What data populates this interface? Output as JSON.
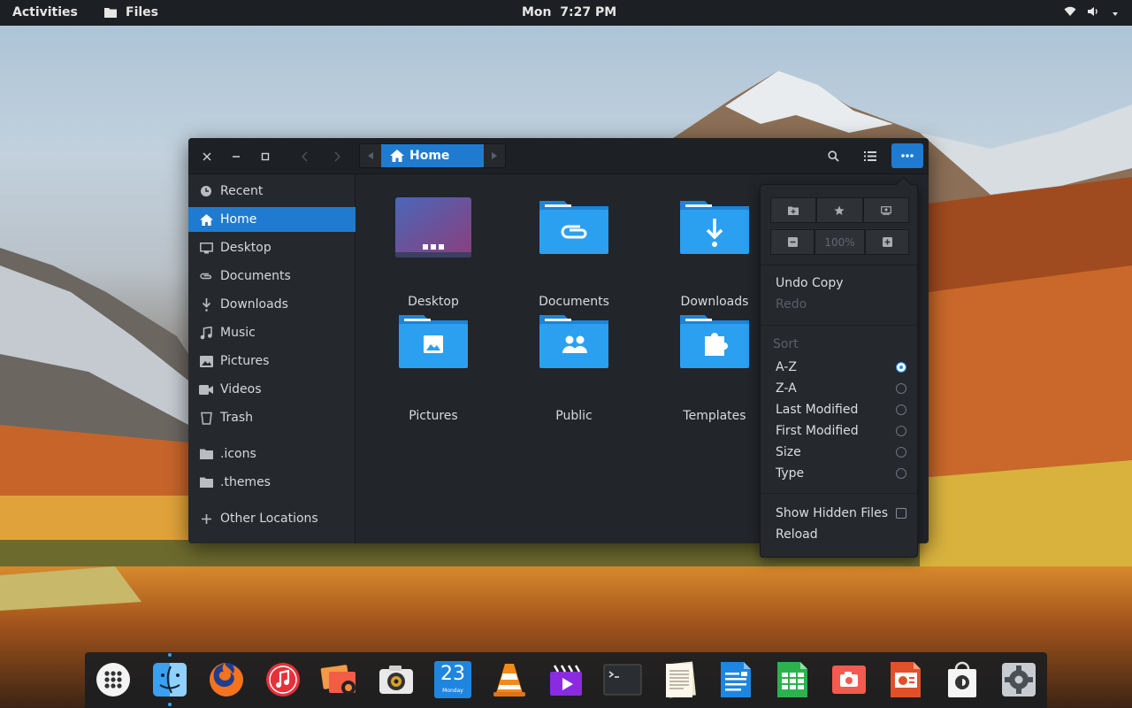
{
  "topbar": {
    "activities": "Activities",
    "app_name": "Files",
    "clock": "Mon  7:27 PM"
  },
  "window": {
    "path": {
      "current": "Home"
    },
    "sidebar": [
      {
        "label": "Recent",
        "icon": "clock-icon"
      },
      {
        "label": "Home",
        "icon": "home-icon",
        "active": true
      },
      {
        "label": "Desktop",
        "icon": "desktop-icon"
      },
      {
        "label": "Documents",
        "icon": "paperclip-icon"
      },
      {
        "label": "Downloads",
        "icon": "download-icon"
      },
      {
        "label": "Music",
        "icon": "music-note-icon"
      },
      {
        "label": "Pictures",
        "icon": "image-icon"
      },
      {
        "label": "Videos",
        "icon": "video-camera-icon"
      },
      {
        "label": "Trash",
        "icon": "trash-icon"
      },
      {
        "label": ".icons",
        "icon": "folder-icon"
      },
      {
        "label": ".themes",
        "icon": "folder-icon"
      },
      {
        "label": "Other Locations",
        "icon": "plus-icon"
      }
    ],
    "files": [
      {
        "label": "Desktop"
      },
      {
        "label": "Documents"
      },
      {
        "label": "Downloads"
      },
      {
        "label": "Pictures"
      },
      {
        "label": "Public"
      },
      {
        "label": "Templates"
      }
    ]
  },
  "menu": {
    "zoom": "100%",
    "undo": "Undo Copy",
    "redo": "Redo",
    "sort_title": "Sort",
    "sort_options": [
      {
        "label": "A-Z",
        "selected": true
      },
      {
        "label": "Z-A",
        "selected": false
      },
      {
        "label": "Last Modified",
        "selected": false
      },
      {
        "label": "First Modified",
        "selected": false
      },
      {
        "label": "Size",
        "selected": false
      },
      {
        "label": "Type",
        "selected": false
      }
    ],
    "show_hidden": "Show Hidden Files",
    "reload": "Reload"
  },
  "dock": {
    "calendar_day": "23",
    "calendar_sub": "Monday"
  },
  "colors": {
    "accent": "#1e7bd0",
    "folder": "#2ba0f0"
  }
}
